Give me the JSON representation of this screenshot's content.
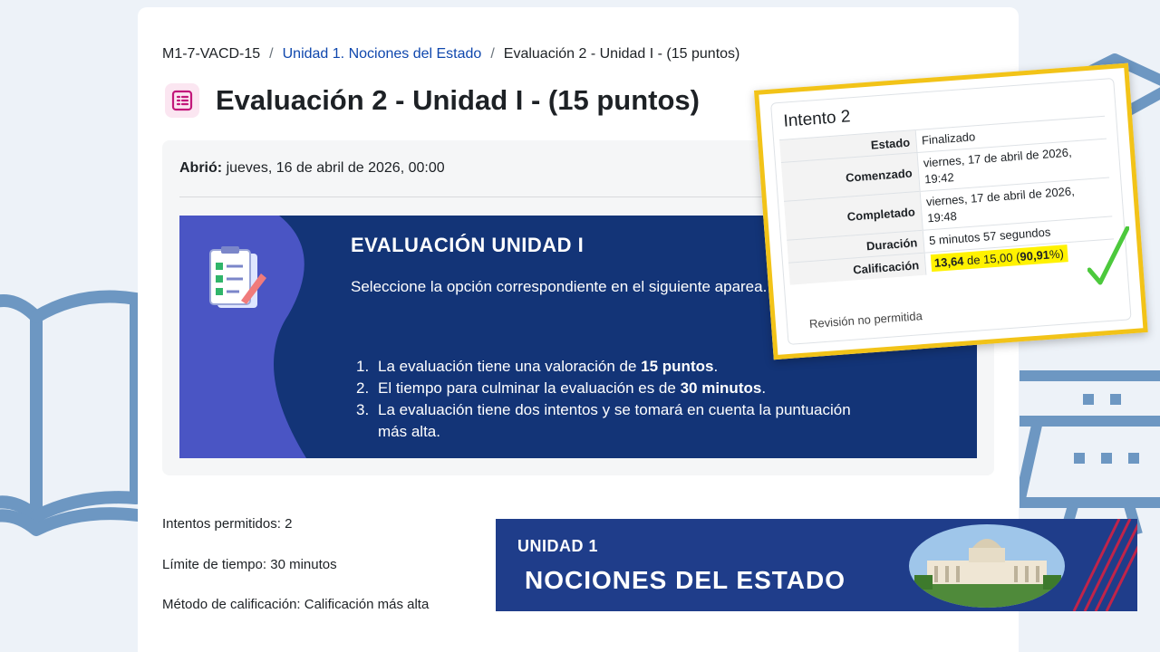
{
  "breadcrumb": [
    {
      "label": "M1-7-VACD-15"
    },
    {
      "label": "Unidad 1. Nociones del Estado"
    },
    {
      "label": "Evaluación 2 - Unidad I - (15 puntos)"
    }
  ],
  "page_title": "Evaluación 2 - Unidad I - (15 puntos)",
  "opened": {
    "label": "Abrió:",
    "value": "jueves, 16 de abril de 2026, 00:00"
  },
  "banner": {
    "title": "EVALUACIÓN UNIDAD I",
    "intro": "Seleccione la opción correspondiente en el siguiente aparea.",
    "items": [
      {
        "num": "1.",
        "pre": "La evaluación tiene una valoración de ",
        "bold": "15 puntos",
        "post": "."
      },
      {
        "num": "2.",
        "pre": "El tiempo para culminar la evaluación es de ",
        "bold": "30 minutos",
        "post": "."
      },
      {
        "num": "3.",
        "pre": "La evaluación tiene dos intentos y se tomará en cuenta la puntuación más alta.",
        "bold": "",
        "post": ""
      }
    ]
  },
  "meta": {
    "attempts": "Intentos permitidos: 2",
    "time_limit": "Límite de tiempo: 30 minutos",
    "grading_method": "Método de calificación: Calificación más alta"
  },
  "unit_banner": {
    "label": "UNIDAD 1",
    "name": "NOCIONES DEL ESTADO"
  },
  "attempt": {
    "title": "Intento 2",
    "rows": [
      {
        "label": "Estado",
        "value": "Finalizado"
      },
      {
        "label": "Comenzado",
        "value": "viernes, 17 de abril de 2026, 19:42"
      },
      {
        "label": "Completado",
        "value": "viernes, 17 de abril de 2026, 19:48"
      },
      {
        "label": "Duración",
        "value": "5 minutos 57 segundos"
      }
    ],
    "grade": {
      "label": "Calificación",
      "score": "13,64",
      "of": "de 15,00",
      "percent_open": "(",
      "percent": "90,91",
      "percent_close": "%)"
    },
    "review_note": "Revisión no permitida"
  },
  "colors": {
    "banner_bg": "#133477",
    "highlight": "#fff200",
    "popup_border": "#f2c318",
    "check": "#4cc93c",
    "link": "#0f47ad"
  }
}
